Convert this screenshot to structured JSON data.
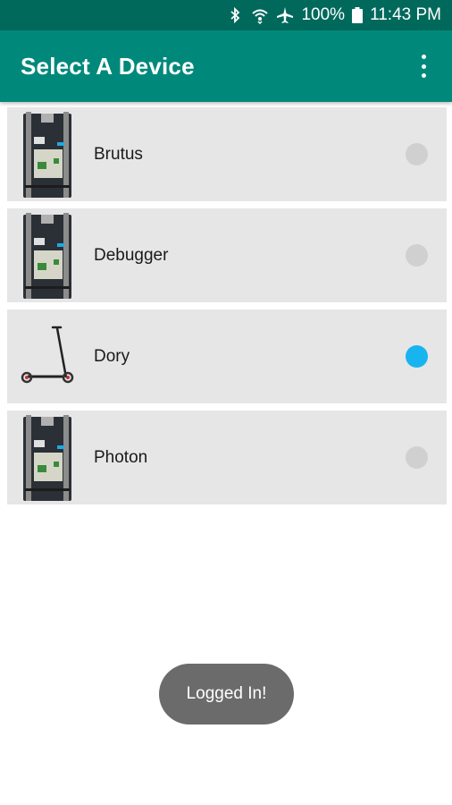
{
  "status_bar": {
    "battery": "100%",
    "time": "11:43 PM",
    "icons": [
      "bluetooth-icon",
      "wifi-icon",
      "airplane-icon",
      "battery-icon"
    ]
  },
  "app_bar": {
    "title": "Select A Device",
    "menu_icon": "overflow-menu-icon"
  },
  "devices": [
    {
      "name": "Brutus",
      "image": "photon-board",
      "selected": false
    },
    {
      "name": "Debugger",
      "image": "photon-board",
      "selected": false
    },
    {
      "name": "Dory",
      "image": "scooter",
      "selected": true
    },
    {
      "name": "Photon",
      "image": "photon-board",
      "selected": false
    }
  ],
  "toast": {
    "message": "Logged In!"
  },
  "colors": {
    "status_bar": "#00695c",
    "app_bar": "#00897b",
    "radio_selected": "#18b4f0",
    "radio_unselected": "#d0d0d0",
    "toast": "#6b6b6b"
  }
}
